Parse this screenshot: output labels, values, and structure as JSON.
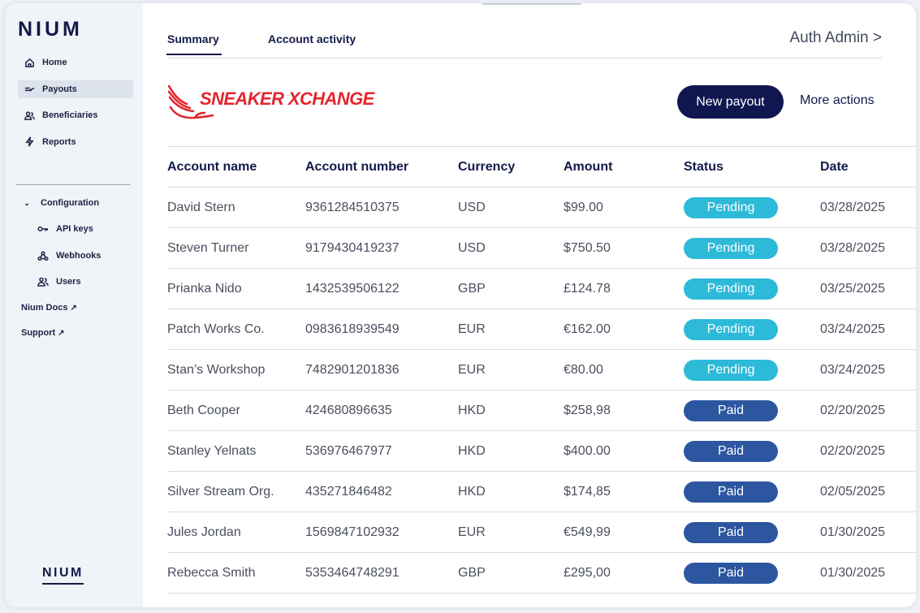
{
  "sidebar": {
    "brand": "NIUM",
    "nav": [
      {
        "label": "Home",
        "icon": "home-icon"
      },
      {
        "label": "Payouts",
        "icon": "payout-icon",
        "active": true
      },
      {
        "label": "Beneficiaries",
        "icon": "users-icon"
      },
      {
        "label": "Reports",
        "icon": "bolt-icon"
      }
    ],
    "config_label": "Configuration",
    "config_items": [
      {
        "label": "API keys",
        "icon": "key-icon"
      },
      {
        "label": "Webhooks",
        "icon": "webhook-icon"
      },
      {
        "label": "Users",
        "icon": "users-icon"
      }
    ],
    "docs_label": "Nium Docs",
    "support_label": "Support",
    "external_glyph": "↗",
    "footer_brand": "NIUM"
  },
  "header": {
    "tabs": [
      "Summary",
      "Account activity"
    ],
    "active_tab": "Summary",
    "user": "Auth Admin >"
  },
  "merchant": {
    "logo_text": "SNEAKER XCHANGE",
    "logo_color": "#e3262e"
  },
  "actions": {
    "primary": "New payout",
    "secondary": "More actions"
  },
  "table": {
    "columns": [
      "Account name",
      "Account number",
      "Currency",
      "Amount",
      "Status",
      "Date"
    ],
    "rows": [
      {
        "name": "David Stern",
        "number": "9361284510375",
        "currency": "USD",
        "amount": "$99.00",
        "status": "Pending",
        "date": "03/28/2025"
      },
      {
        "name": "Steven Turner",
        "number": "9179430419237",
        "currency": "USD",
        "amount": "$750.50",
        "status": "Pending",
        "date": "03/28/2025"
      },
      {
        "name": "Prianka Nido",
        "number": "1432539506122",
        "currency": "GBP",
        "amount": "£124.78",
        "status": "Pending",
        "date": "03/25/2025"
      },
      {
        "name": "Patch Works Co.",
        "number": "0983618939549",
        "currency": "EUR",
        "amount": "€162.00",
        "status": "Pending",
        "date": "03/24/2025"
      },
      {
        "name": "Stan’s Workshop",
        "number": "7482901201836",
        "currency": "EUR",
        "amount": "€80.00",
        "status": "Pending",
        "date": "03/24/2025"
      },
      {
        "name": "Beth Cooper",
        "number": "424680896635",
        "currency": "HKD",
        "amount": "$258,98",
        "status": "Paid",
        "date": "02/20/2025"
      },
      {
        "name": "Stanley Yelnats",
        "number": "536976467977",
        "currency": "HKD",
        "amount": "$400.00",
        "status": "Paid",
        "date": "02/20/2025"
      },
      {
        "name": "Silver Stream Org.",
        "number": "435271846482",
        "currency": "HKD",
        "amount": "$174,85",
        "status": "Paid",
        "date": "02/05/2025"
      },
      {
        "name": "Jules Jordan",
        "number": "1569847102932",
        "currency": "EUR",
        "amount": "€549,99",
        "status": "Paid",
        "date": "01/30/2025"
      },
      {
        "name": "Rebecca Smith",
        "number": "5353464748291",
        "currency": "GBP",
        "amount": "£295,00",
        "status": "Paid",
        "date": "01/30/2025"
      }
    ]
  },
  "colors": {
    "navy": "#0f1650",
    "pending": "#2dbad9",
    "paid": "#2c56a0"
  }
}
